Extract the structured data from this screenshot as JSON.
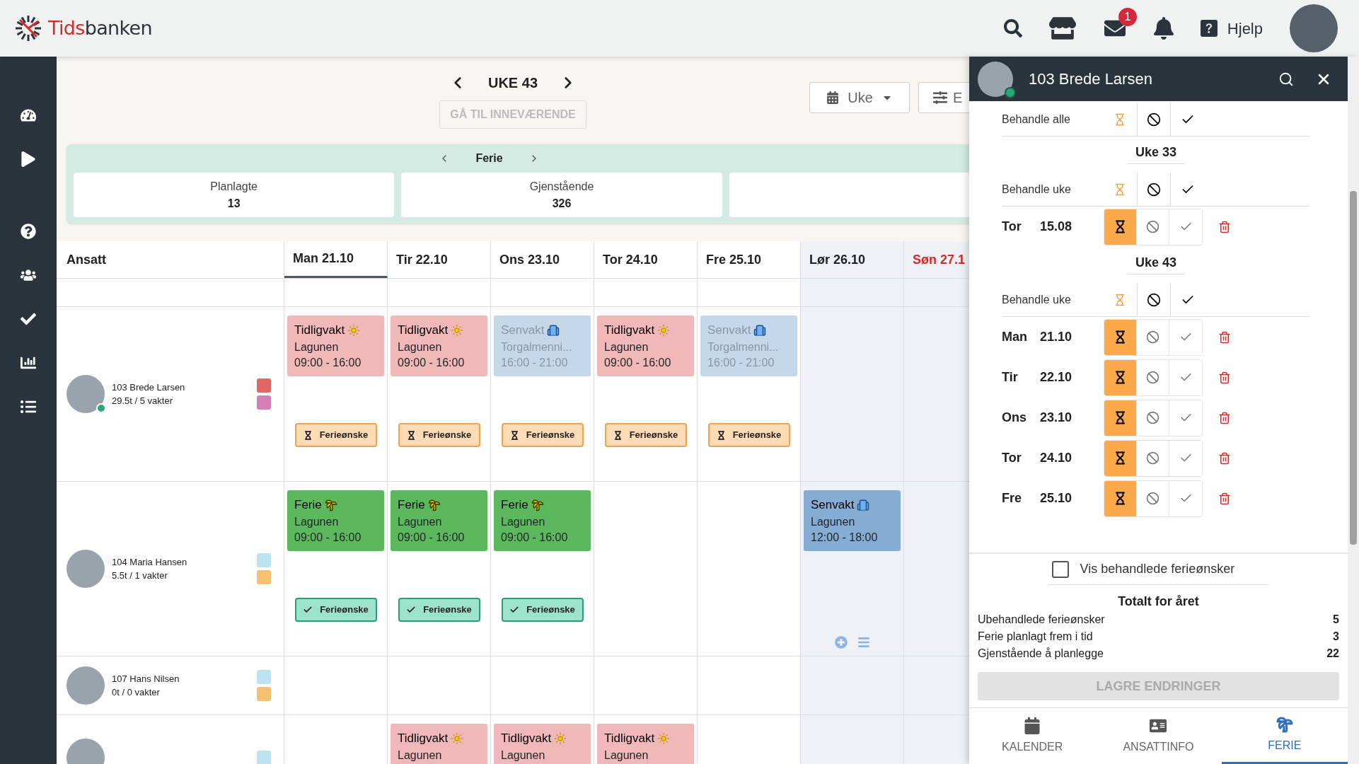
{
  "header": {
    "logo": {
      "accent": "Tids",
      "rest": "banken"
    },
    "mail_badge": "1",
    "help": "Hjelp"
  },
  "week_nav": {
    "title": "UKE 43",
    "today_button": "GÅ TIL INNEVÆRENDE",
    "view_select": "Uke",
    "filter_button": "E"
  },
  "summary": {
    "title": "Ferie",
    "cards": [
      {
        "label": "Planlagte",
        "value": "13"
      },
      {
        "label": "Gjenstående",
        "value": "326"
      }
    ]
  },
  "schedule": {
    "columns": [
      {
        "label": "Ansatt"
      },
      {
        "label": "Man 21.10",
        "selected": true,
        "weekend": false,
        "holiday": false
      },
      {
        "label": "Tir 22.10",
        "selected": false,
        "weekend": false,
        "holiday": false
      },
      {
        "label": "Ons 23.10",
        "selected": false,
        "weekend": false,
        "holiday": false
      },
      {
        "label": "Tor 24.10",
        "selected": false,
        "weekend": false,
        "holiday": false
      },
      {
        "label": "Fre 25.10",
        "selected": false,
        "weekend": false,
        "holiday": false
      },
      {
        "label": "Lør 26.10",
        "selected": false,
        "weekend": true,
        "holiday": false
      },
      {
        "label": "Søn 27.1",
        "selected": false,
        "weekend": true,
        "holiday": true
      }
    ],
    "employees": [
      {
        "name": "103 Brede Larsen",
        "hours": "29.5t / 5 vakter",
        "online": true,
        "tags": [
          {
            "color": "#e06666"
          },
          {
            "color": "#d67fb5"
          }
        ],
        "days": [
          {
            "kind": "shift",
            "shift": {
              "kind": "early",
              "title": "Tidligvakt",
              "place": "Lagunen",
              "time": "09:00 - 16:00",
              "faded": false
            },
            "request": {
              "approved": false,
              "label": "Ferieønske"
            }
          },
          {
            "kind": "shift",
            "shift": {
              "kind": "early",
              "title": "Tidligvakt",
              "place": "Lagunen",
              "time": "09:00 - 16:00",
              "faded": false
            },
            "request": {
              "approved": false,
              "label": "Ferieønske"
            }
          },
          {
            "kind": "shift",
            "shift": {
              "kind": "late",
              "title": "Senvakt",
              "place": "Torgalmenni...",
              "time": "16:00 - 21:00",
              "faded": true
            },
            "request": {
              "approved": false,
              "label": "Ferieønske"
            }
          },
          {
            "kind": "shift",
            "shift": {
              "kind": "early",
              "title": "Tidligvakt",
              "place": "Lagunen",
              "time": "09:00 - 16:00",
              "faded": false
            },
            "request": {
              "approved": false,
              "label": "Ferieønske"
            }
          },
          {
            "kind": "shift",
            "shift": {
              "kind": "late",
              "title": "Senvakt",
              "place": "Torgalmenni...",
              "time": "16:00 - 21:00",
              "faded": true
            },
            "request": {
              "approved": false,
              "label": "Ferieønske"
            }
          },
          {
            "kind": "empty"
          },
          {
            "kind": "empty"
          }
        ]
      },
      {
        "name": "104 Maria Hansen",
        "hours": "5.5t / 1 vakter",
        "online": false,
        "tags": [
          {
            "color": "#bde3f3"
          },
          {
            "color": "#f5c070"
          }
        ],
        "days": [
          {
            "kind": "shift",
            "shift": {
              "kind": "vacation",
              "title": "Ferie",
              "place": "Lagunen",
              "time": "09:00 - 16:00",
              "faded": false
            },
            "request": {
              "approved": true,
              "label": "Ferieønske"
            }
          },
          {
            "kind": "shift",
            "shift": {
              "kind": "vacation",
              "title": "Ferie",
              "place": "Lagunen",
              "time": "09:00 - 16:00",
              "faded": false
            },
            "request": {
              "approved": true,
              "label": "Ferieønske"
            }
          },
          {
            "kind": "shift",
            "shift": {
              "kind": "vacation",
              "title": "Ferie",
              "place": "Lagunen",
              "time": "09:00 - 16:00",
              "faded": false
            },
            "request": {
              "approved": true,
              "label": "Ferieønske"
            }
          },
          {
            "kind": "empty"
          },
          {
            "kind": "empty"
          },
          {
            "kind": "shift",
            "shift": {
              "kind": "late",
              "title": "Senvakt",
              "place": "Lagunen",
              "time": "12:00 - 18:00",
              "faded": false
            },
            "hovered": true
          },
          {
            "kind": "empty"
          }
        ]
      },
      {
        "name": "107 Hans Nilsen",
        "hours": "0t / 0 vakter",
        "online": false,
        "tags": [
          {
            "color": "#bde3f3"
          },
          {
            "color": "#f5c070"
          }
        ],
        "days": [
          {
            "kind": "empty"
          },
          {
            "kind": "empty"
          },
          {
            "kind": "empty"
          },
          {
            "kind": "empty"
          },
          {
            "kind": "empty"
          },
          {
            "kind": "empty"
          },
          {
            "kind": "empty"
          }
        ]
      },
      {
        "tags": [
          {
            "color": "#bde3f3"
          }
        ],
        "days": [
          {
            "kind": "empty"
          },
          {
            "kind": "shift",
            "shift": {
              "kind": "early",
              "title": "Tidligvakt",
              "place": "Lagunen",
              "faded": false
            }
          },
          {
            "kind": "shift",
            "shift": {
              "kind": "early",
              "title": "Tidligvakt",
              "place": "Lagunen",
              "faded": false
            }
          },
          {
            "kind": "shift",
            "shift": {
              "kind": "early",
              "title": "Tidligvakt",
              "place": "Lagunen",
              "faded": false
            }
          },
          {
            "kind": "empty"
          },
          {
            "kind": "empty"
          },
          {
            "kind": "empty"
          }
        ]
      }
    ]
  },
  "panel": {
    "employee": "103 Brede Larsen",
    "online": true,
    "bulk_all": "Behandle alle",
    "weeks": [
      {
        "title": "Uke 33",
        "bulk_label": "Behandle uke",
        "items": [
          {
            "day": "Tor",
            "date": "15.08",
            "rejected": false,
            "approved": false
          }
        ]
      },
      {
        "title": "Uke 43",
        "bulk_label": "Behandle uke",
        "items": [
          {
            "day": "Man",
            "date": "21.10",
            "rejected": false,
            "approved": false
          },
          {
            "day": "Tir",
            "date": "22.10",
            "rejected": false,
            "approved": false
          },
          {
            "day": "Ons",
            "date": "23.10",
            "rejected": false,
            "approved": false
          },
          {
            "day": "Tor",
            "date": "24.10",
            "rejected": false,
            "approved": false
          },
          {
            "day": "Fre",
            "date": "25.10",
            "rejected": false,
            "approved": false
          }
        ]
      }
    ],
    "show_processed": {
      "label": "Vis behandlede ferieønsker",
      "checked": false
    },
    "totals": {
      "title": "Totalt for året",
      "rows": [
        {
          "label": "Ubehandlede ferieønsker",
          "value": "5"
        },
        {
          "label": "Ferie planlagt frem i tid",
          "value": "3"
        },
        {
          "label": "Gjenstående å planlegge",
          "value": "22"
        }
      ]
    },
    "save_button": {
      "label": "LAGRE ENDRINGER",
      "disabled": true
    },
    "tabs": [
      {
        "kind": "calendar",
        "label": "KALENDER",
        "selected": false
      },
      {
        "kind": "id-card",
        "label": "ANSATTINFO",
        "selected": false
      },
      {
        "kind": "palm",
        "label": "FERIE",
        "selected": true
      }
    ]
  }
}
